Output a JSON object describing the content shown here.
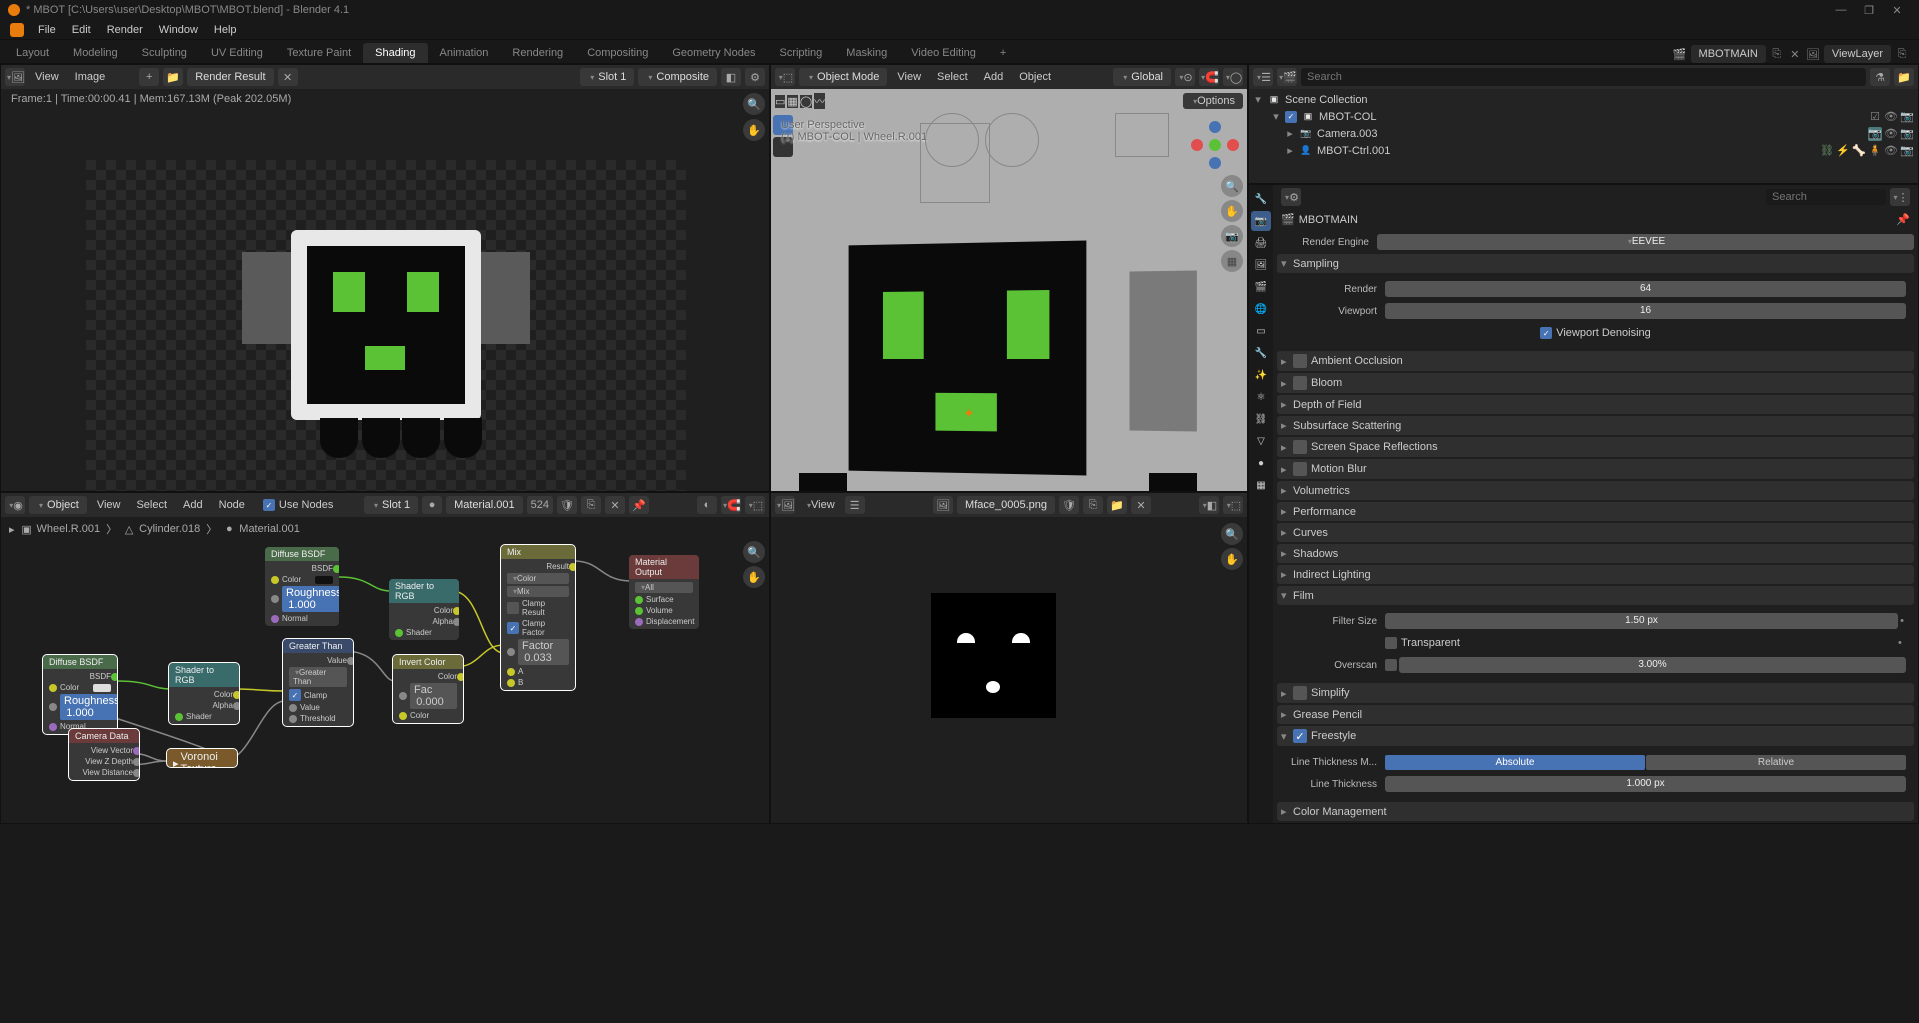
{
  "title": "* MBOT [C:\\Users\\user\\Desktop\\MBOT\\MBOT.blend] - Blender 4.1",
  "topmenu": [
    "File",
    "Edit",
    "Render",
    "Window",
    "Help"
  ],
  "workspaces": [
    "Layout",
    "Modeling",
    "Sculpting",
    "UV Editing",
    "Texture Paint",
    "Shading",
    "Animation",
    "Rendering",
    "Compositing",
    "Geometry Nodes",
    "Scripting",
    "Masking",
    "Video Editing"
  ],
  "active_workspace": "Shading",
  "scene_name": "MBOTMAIN",
  "viewlayer_name": "ViewLayer",
  "render_status": "Frame:1 | Time:00:00.41 | Mem:167.13M (Peak 202.05M)",
  "render_header": {
    "view": "View",
    "image": "Image",
    "linked": "Render Result",
    "slot": "Slot 1",
    "layer": "Composite"
  },
  "viewport_header": {
    "mode": "Object Mode",
    "menus": [
      "View",
      "Select",
      "Add",
      "Object"
    ],
    "orientation": "Global"
  },
  "viewport_hdr2": {
    "options": "Options"
  },
  "viewport_overlay": {
    "perspective": "User Perspective",
    "object": "(1) MBOT-COL | Wheel.R.001"
  },
  "outliner": {
    "root": "Scene Collection",
    "items": [
      {
        "name": "MBOT-COL",
        "type": "collection",
        "depth": 1,
        "expanded": true
      },
      {
        "name": "Camera.003",
        "type": "camera",
        "depth": 2
      },
      {
        "name": "MBOT-Ctrl.001",
        "type": "armature",
        "depth": 2
      }
    ],
    "search_placeholder": "Search"
  },
  "props": {
    "breadcrumb": "MBOTMAIN",
    "render_engine_label": "Render Engine",
    "render_engine": "EEVEE",
    "sampling": {
      "title": "Sampling",
      "render_label": "Render",
      "render": "64",
      "viewport_label": "Viewport",
      "viewport": "16",
      "denoise_label": "Viewport Denoising"
    },
    "sections": [
      "Ambient Occlusion",
      "Bloom",
      "Depth of Field",
      "Subsurface Scattering",
      "Screen Space Reflections",
      "Motion Blur",
      "Volumetrics",
      "Performance",
      "Curves",
      "Shadows",
      "Indirect Lighting"
    ],
    "film": {
      "title": "Film",
      "filter_label": "Filter Size",
      "filter": "1.50 px",
      "transparent_label": "Transparent",
      "overscan_label": "Overscan",
      "overscan": "3.00%"
    },
    "simplify": "Simplify",
    "gp": "Grease Pencil",
    "freestyle": {
      "title": "Freestyle",
      "mode_label": "Line Thickness M...",
      "mode_abs": "Absolute",
      "mode_rel": "Relative",
      "thickness_label": "Line Thickness",
      "thickness": "1.000 px"
    },
    "color_mgmt": "Color Management"
  },
  "nodeed": {
    "menus": [
      "View",
      "Select",
      "Add",
      "Node"
    ],
    "use_nodes": "Use Nodes",
    "mode": "Object",
    "slot": "Slot 1",
    "material": "Material.001",
    "users": "524",
    "path": [
      "Wheel.R.001",
      "Cylinder.018",
      "Material.001"
    ],
    "nodes": {
      "diff1": {
        "title": "Diffuse BSDF",
        "bsdf": "BSDF",
        "color": "Color",
        "rough": "Roughness",
        "rough_v": "1.000",
        "normal": "Normal"
      },
      "diff2": {
        "title": "Diffuse BSDF",
        "bsdf": "BSDF",
        "color": "Color",
        "rough": "Roughness",
        "rough_v": "1.000",
        "normal": "Normal"
      },
      "srgb1": {
        "title": "Shader to RGB",
        "color": "Color",
        "alpha": "Alpha",
        "shader": "Shader"
      },
      "srgb2": {
        "title": "Shader to RGB",
        "color": "Color",
        "alpha": "Alpha",
        "shader": "Shader"
      },
      "gt": {
        "title": "Greater Than",
        "value": "Value",
        "gtl": "Greater Than",
        "clamp": "Clamp",
        "vall": "Value",
        "thresh": "Threshold"
      },
      "inv": {
        "title": "Invert Color",
        "color": "Color",
        "fac": "Fac",
        "fac_v": "0.000",
        "colorl": "Color"
      },
      "mix": {
        "title": "Mix",
        "result": "Result",
        "colorl": "Color",
        "mixl": "Mix",
        "clampr": "Clamp Result",
        "clampf": "Clamp Factor",
        "factor": "Factor",
        "factor_v": "0.033",
        "a": "A",
        "b": "B"
      },
      "mout": {
        "title": "Material Output",
        "all": "All",
        "surface": "Surface",
        "volume": "Volume",
        "disp": "Displacement"
      },
      "cam": {
        "title": "Camera Data",
        "vv": "View Vector",
        "vz": "View Z Depth",
        "vd": "View Distance"
      },
      "vor": {
        "title": "Voronoi Texture"
      }
    }
  },
  "imged": {
    "view": "View",
    "filename": "Mface_0005.png"
  }
}
